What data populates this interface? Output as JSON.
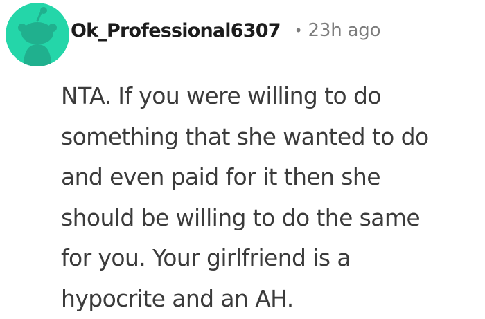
{
  "comment": {
    "author": "Ok_Professional6307",
    "separator": "•",
    "timestamp": "23h ago",
    "body_lines": [
      "NTA. If you were willing to do",
      "something that she wanted to do",
      "and even paid for it then she",
      "should be willing to do the same",
      "for you. Your girlfriend is a",
      "hypocrite and an AH."
    ]
  },
  "avatar": {
    "icon": "snoo-avatar-icon",
    "background_color": "#24d6a9",
    "figure_color": "#20b08e"
  },
  "colors": {
    "username": "#1c1c1c",
    "meta": "#7c7c7c",
    "body_text": "#3b3b3b",
    "page_background": "#ffffff"
  }
}
